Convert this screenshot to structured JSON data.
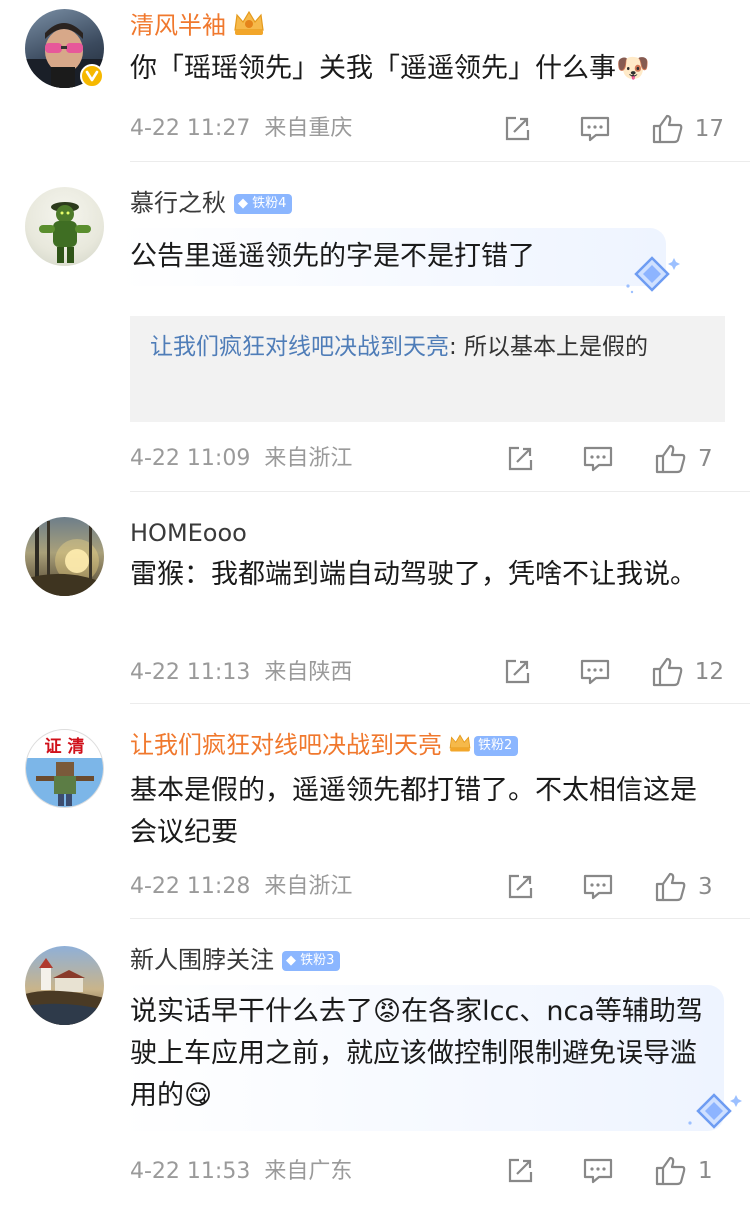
{
  "comments": [
    {
      "user": "清风半袖",
      "text": "你「瑶瑶领先」关我「遥遥领先」什么事",
      "emoji": "🐶",
      "time": "4-22 11:27",
      "location": "来自重庆",
      "likes": "17"
    },
    {
      "user": "慕行之秋",
      "badge": "铁粉4",
      "text": "公告里遥遥领先的字是不是打错了",
      "quote_user": "让我们疯狂对线吧决战到天亮",
      "quote_text": ": 所以基本上是假的",
      "time": "4-22 11:09",
      "location": "来自浙江",
      "likes": "7"
    },
    {
      "user": "HOMEooo",
      "text": "雷猴：我都端到端自动驾驶了，凭啥不让我说。",
      "time": "4-22 11:13",
      "location": "来自陕西",
      "likes": "12"
    },
    {
      "user": "让我们疯狂对线吧决战到天亮",
      "badge": "铁粉2",
      "avatar_text": "证 清",
      "text": "基本是假的，遥遥领先都打错了。不太相信这是会议纪要",
      "time": "4-22 11:28",
      "location": "来自浙江",
      "likes": "3"
    },
    {
      "user": "新人围脖关注",
      "badge": "铁粉3",
      "text_a": "说实话早干什么去了",
      "emoji_a": "😡",
      "text_b": "在各家lcc、nca等辅助驾驶上车应用之前，就应该做控制限制避免误导滥用的",
      "emoji_b": "😋",
      "time": "4-22 11:53",
      "location": "来自广东",
      "likes": "1"
    }
  ],
  "icons": {
    "share": "share-icon",
    "comment": "comment-icon",
    "like": "thumbs-up-icon",
    "verified": "verified-badge-icon",
    "crown": "crown-icon",
    "diamond": "diamond-fan-icon"
  },
  "colors": {
    "vip_name": "#f0782d",
    "quote_name": "#4f7db8",
    "badge": "#8bb6ff",
    "meta": "#9a9a9a"
  }
}
